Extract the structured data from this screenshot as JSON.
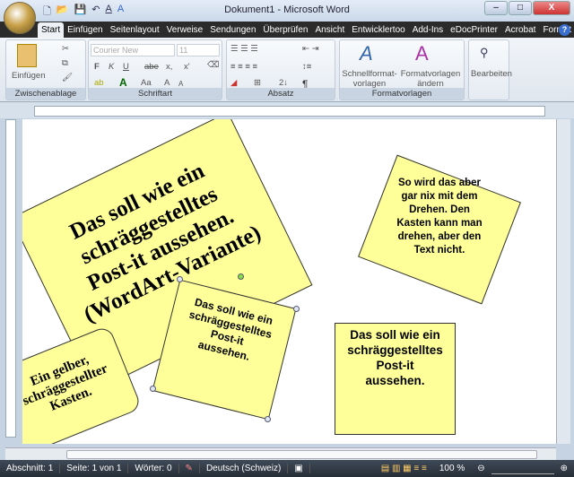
{
  "window": {
    "title": "Dokument1 - Microsoft Word",
    "minimize": "–",
    "maximize": "□",
    "close": "X"
  },
  "tabs": [
    "Start",
    "Einfügen",
    "Seitenlayout",
    "Verweise",
    "Sendungen",
    "Überprüfen",
    "Ansicht",
    "Entwicklertoo",
    "Add-Ins",
    "eDocPrinter",
    "Acrobat",
    "Format"
  ],
  "ribbon": {
    "clipboard": {
      "label": "Zwischenablage",
      "paste": "Einfügen"
    },
    "font": {
      "label": "Schriftart",
      "font_name": "Courier New",
      "font_size": "11",
      "bold": "F",
      "italic": "K",
      "underline": "U",
      "strike": "abe",
      "sub": "x,",
      "sup": "x'",
      "case": "Aa",
      "grow": "A",
      "shrink": "A"
    },
    "paragraph": {
      "label": "Absatz",
      "pilcrow": "¶",
      "sort": "2↓"
    },
    "styles": {
      "label": "Formatvorlagen",
      "quick_styles": "Schnellformat-",
      "quick_styles2": "vorlagen",
      "change_styles": "Formatvorlagen",
      "change_styles2": "ändern"
    },
    "editing": {
      "label": "Bearbeiten"
    }
  },
  "document": {
    "wordart": [
      "Das soll wie ein",
      "schräggestelltes",
      "Post-it aussehen.",
      "(WordArt-Variante)"
    ],
    "rotated_box": [
      "Das soll wie ein",
      "schräggestelltes",
      "Post-it",
      "aussehen."
    ],
    "text_not_rotated": [
      "So wird das aber",
      "gar nix mit dem",
      "Drehen. Den",
      "Kasten kann man",
      "drehen, aber den",
      "Text nicht."
    ],
    "straight_box": [
      "Das soll wie ein",
      "schräggestelltes",
      "Post-it",
      "aussehen."
    ],
    "rounded_box": [
      "Ein gelber,",
      "schräggestellter",
      "Kasten."
    ]
  },
  "status": {
    "section": "Abschnitt: 1",
    "page": "Seite: 1 von 1",
    "words": "Wörter: 0",
    "language": "Deutsch (Schweiz)",
    "zoom": "100 %"
  },
  "colors": {
    "note": "#ffff99",
    "tabbar": "#2b2b2b"
  }
}
